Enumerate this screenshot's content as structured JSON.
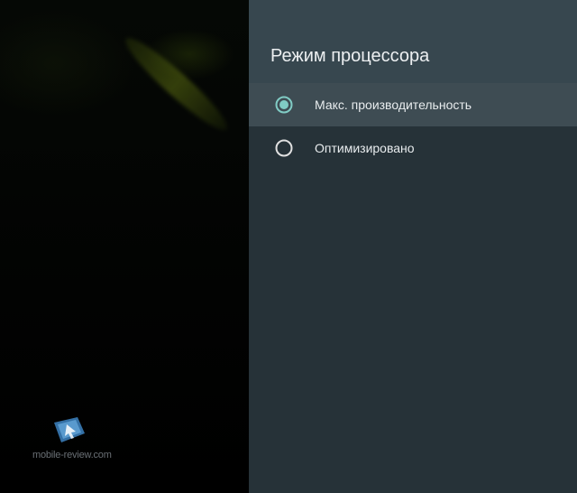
{
  "panel": {
    "title": "Режим процессора",
    "options": [
      {
        "label": "Макс. производительность",
        "selected": true
      },
      {
        "label": "Оптимизировано",
        "selected": false
      }
    ]
  },
  "watermark": {
    "text": "mobile-review.com"
  },
  "colors": {
    "panel_bg": "#263238",
    "header_bg": "#37474f",
    "selected_row_bg": "#3e4c53",
    "radio_accent": "#80cbc4",
    "radio_unchecked": "#e0e0e0"
  },
  "icons": {
    "radio_checked": "radio-checked-icon",
    "radio_unchecked": "radio-unchecked-icon",
    "watermark_logo": "mobile-review-logo"
  }
}
